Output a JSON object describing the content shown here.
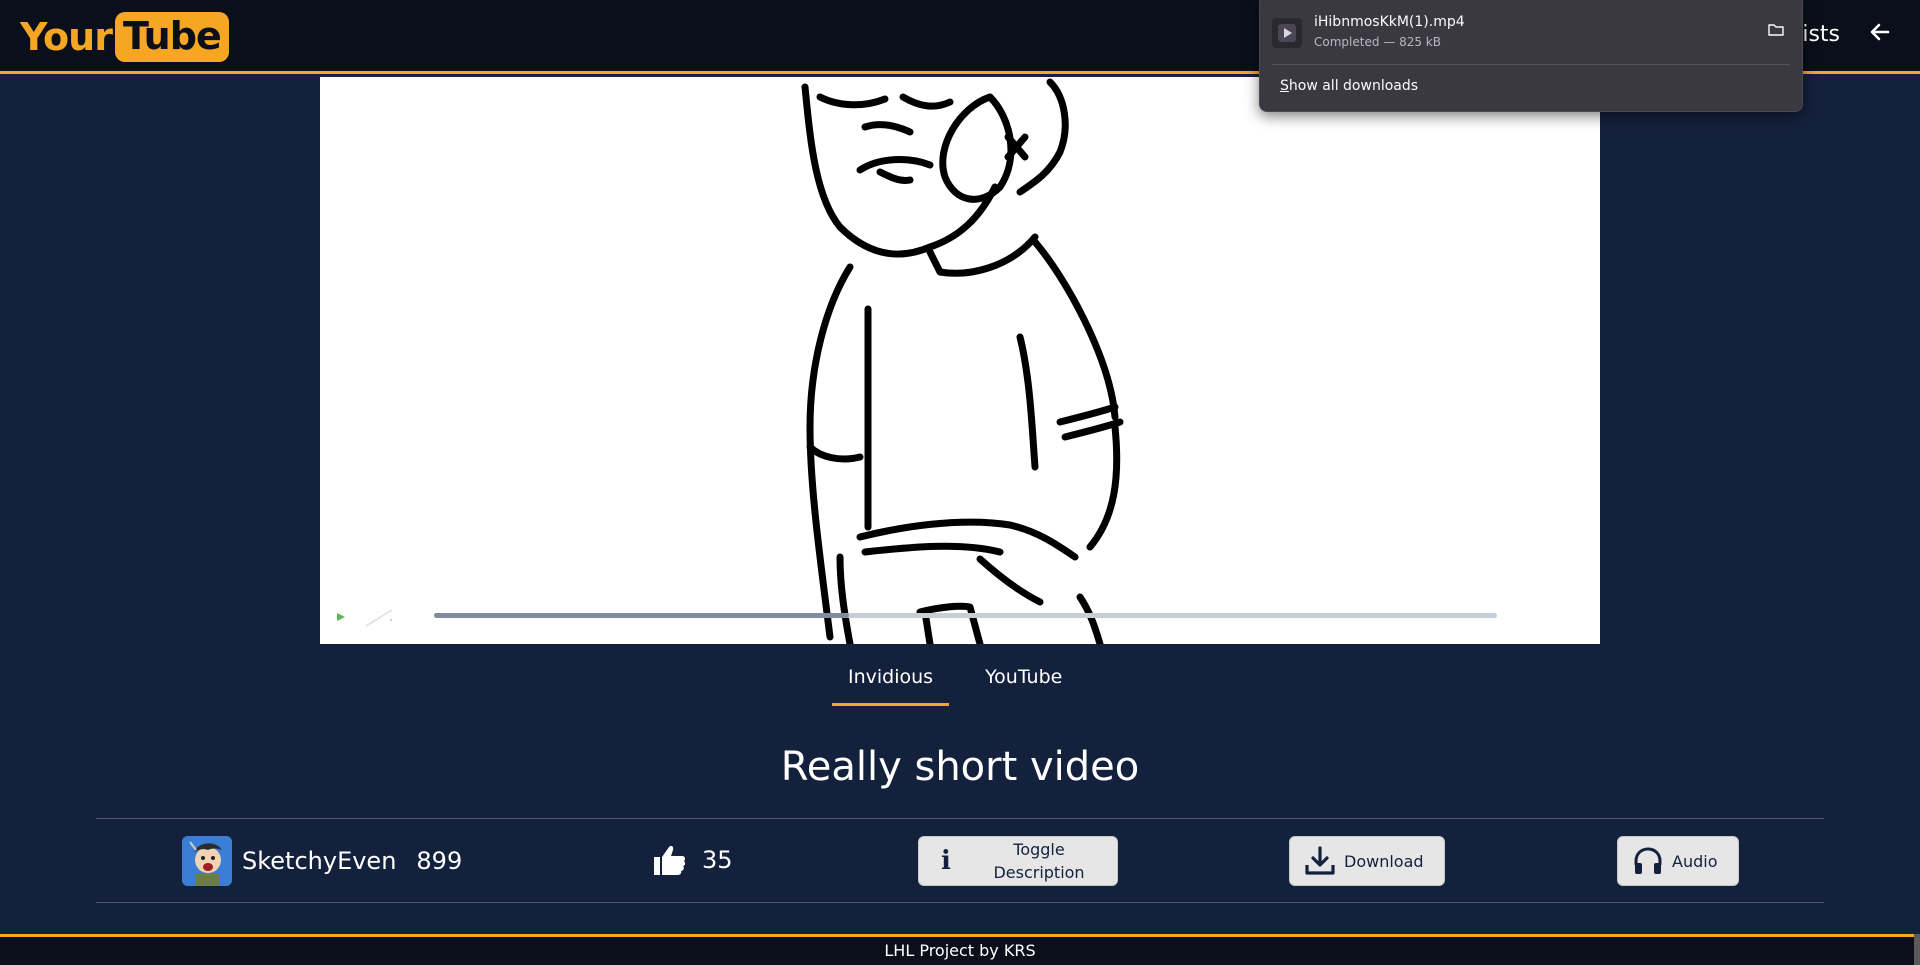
{
  "header": {
    "logo_your": "Your",
    "logo_tube": "Tube",
    "nav_playlists": "Playlists",
    "back_icon": "arrow-left-icon"
  },
  "downloads": {
    "file_name": "iHibnmosKkM(1).mp4",
    "status": "Completed — 825 kB",
    "show_all": "Show all downloads",
    "show_all_accel": "S",
    "show_all_rest": "how all downloads"
  },
  "player": {
    "progress_fraction": 0.39
  },
  "tabs": [
    {
      "label": "Invidious",
      "active": true
    },
    {
      "label": "YouTube",
      "active": false
    }
  ],
  "video": {
    "title": "Really short video",
    "channel_name": "SketchyEven",
    "subscribers": "899",
    "likes": "35"
  },
  "actions": {
    "toggle_line1": "Toggle",
    "toggle_line2": "Description",
    "download": "Download",
    "audio": "Audio"
  },
  "footer": {
    "text": "LHL Project by KRS"
  },
  "colors": {
    "accent": "#f5a623",
    "background": "#14213d",
    "header_bg": "#0b0f1a"
  }
}
